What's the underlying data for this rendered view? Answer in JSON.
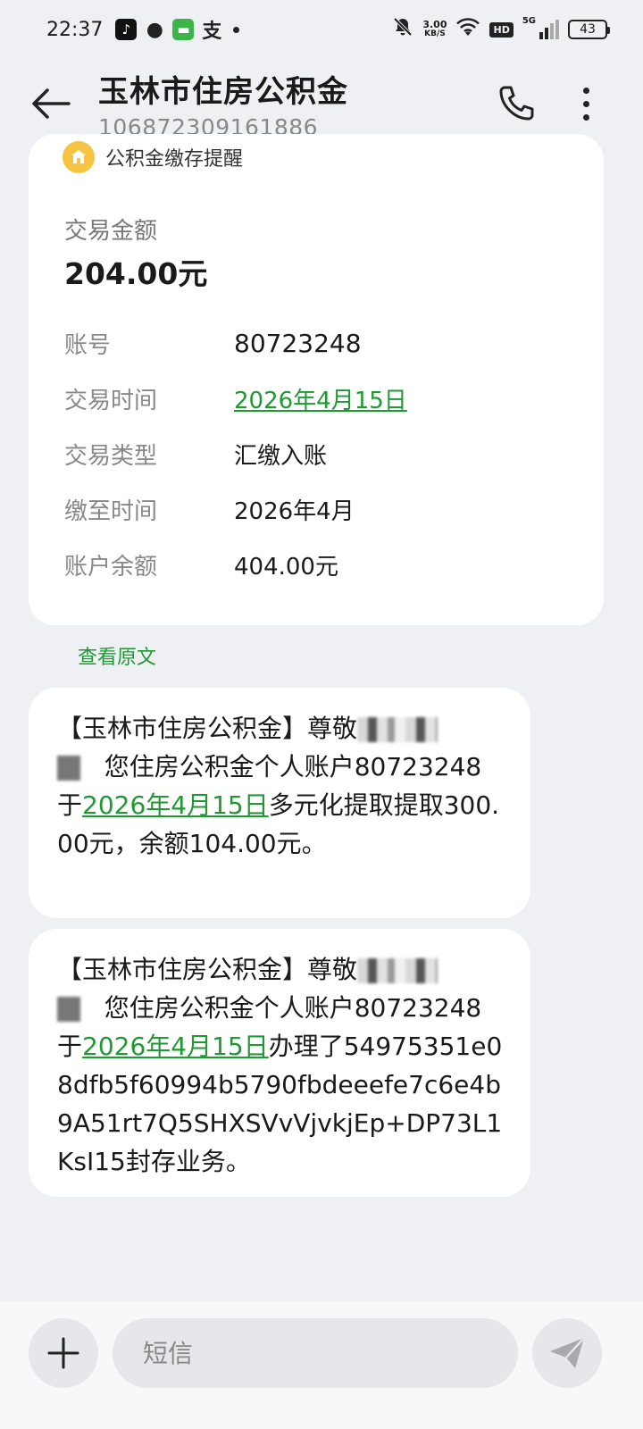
{
  "status_bar": {
    "time": "22:37",
    "net_speed_value": "3.00",
    "net_speed_unit": "KB/S",
    "hd_label": "HD",
    "network_label": "5G",
    "battery": "43"
  },
  "header": {
    "title": "玉林市住房公积金",
    "number": "106872309161886"
  },
  "card": {
    "heading": "公积金缴存提醒",
    "amount_label": "交易金额",
    "amount_value": "204.00元",
    "rows": [
      {
        "key": "账号",
        "value": "80723248"
      },
      {
        "key": "交易时间",
        "value": "2026年4月15日"
      },
      {
        "key": "交易类型",
        "value": "汇缴入账"
      },
      {
        "key": "缴至时间",
        "value": "2026年4月"
      },
      {
        "key": "账户余额",
        "value": "404.00元"
      }
    ]
  },
  "view_original": "查看原文",
  "messages": [
    {
      "p1": "【玉林市住房公积金】尊敬",
      "p2": "您住房公积金个人账户80723248于",
      "date": "2026年4月15日",
      "p3": "多元化提取提取300.00元，余额104.00元。"
    },
    {
      "p1": "【玉林市住房公积金】尊敬",
      "p2": "您住房公积金个人账户80723248于",
      "date": "2026年4月15日",
      "p3": "办理了54975351e08dfb5f60994b5790fbdeeefe7c6e4b9A51rt7Q5SHXSVvVjvkjEp+DP73L1KsI15封存业务。"
    }
  ],
  "composer": {
    "placeholder": "短信"
  },
  "colors": {
    "accent_green": "#1f9a33",
    "background": "#eef0f3",
    "coin_yellow": "#f6c343"
  }
}
